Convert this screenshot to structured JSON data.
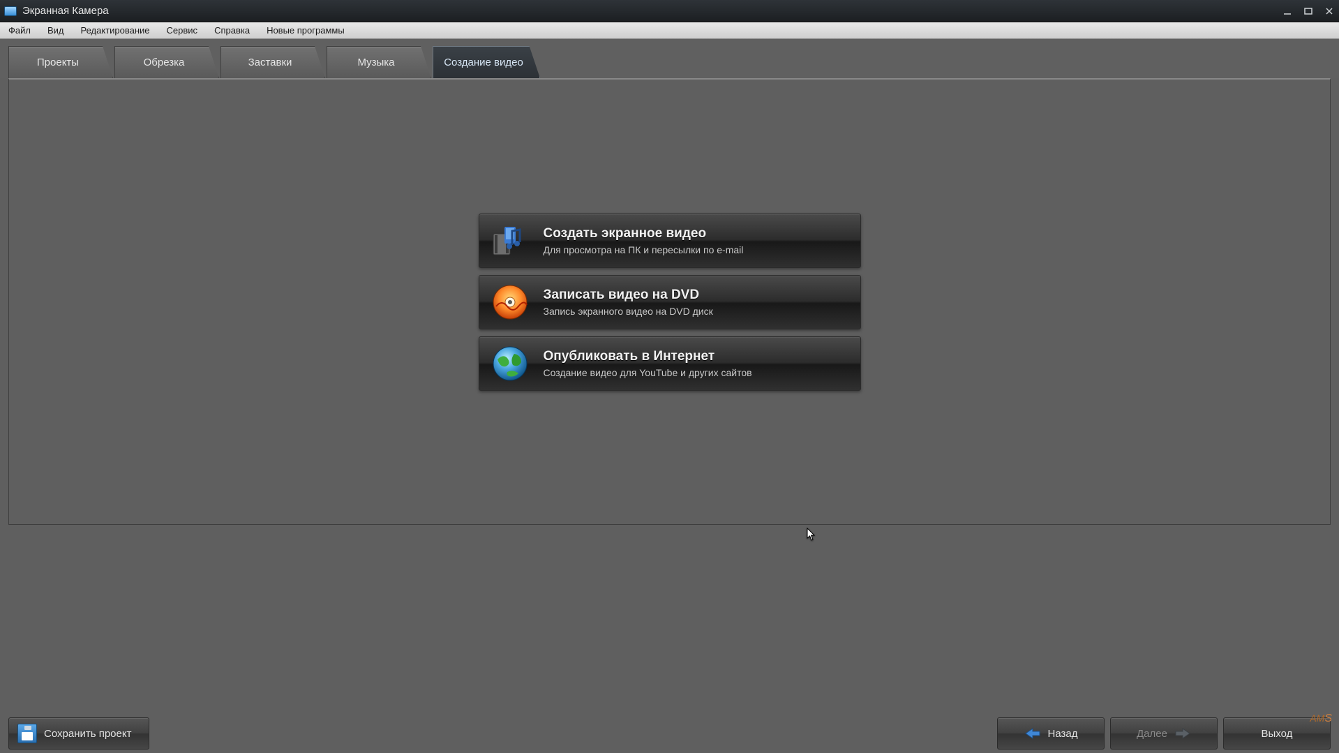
{
  "window": {
    "title": "Экранная Камера"
  },
  "menu": {
    "file": "Файл",
    "view": "Вид",
    "edit": "Редактирование",
    "service": "Сервис",
    "help": "Справка",
    "new_programs": "Новые программы"
  },
  "tabs": {
    "projects": "Проекты",
    "trim": "Обрезка",
    "intros": "Заставки",
    "music": "Музыка",
    "create": "Создание видео"
  },
  "options": {
    "screen": {
      "title": "Создать экранное видео",
      "desc": "Для просмотра на ПК и пересылки по e-mail"
    },
    "dvd": {
      "title": "Записать видео на DVD",
      "desc": "Запись экранного видео на DVD диск"
    },
    "web": {
      "title": "Опубликовать в Интернет",
      "desc": "Создание видео для YouTube и других сайтов"
    }
  },
  "footer": {
    "save": "Сохранить проект",
    "back": "Назад",
    "next": "Далее",
    "exit": "Выход"
  },
  "brand": {
    "a": "AM",
    "s": "S"
  }
}
